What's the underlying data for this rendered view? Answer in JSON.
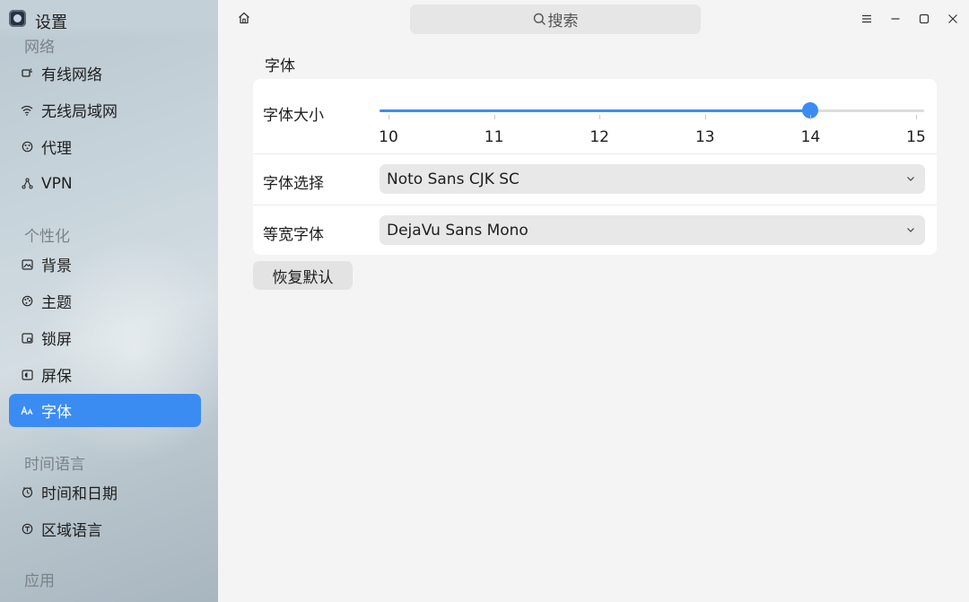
{
  "app": {
    "title": "设置"
  },
  "sidebar": {
    "partial_top_label": "网络",
    "network_items": [
      {
        "label": "有线网络",
        "icon": "wired-network-icon"
      },
      {
        "label": "无线局域网",
        "icon": "wifi-icon"
      },
      {
        "label": "代理",
        "icon": "proxy-icon"
      },
      {
        "label": "VPN",
        "icon": "vpn-icon"
      }
    ],
    "personalization_label": "个性化",
    "personalization_items": [
      {
        "label": "背景",
        "icon": "wallpaper-icon"
      },
      {
        "label": "主题",
        "icon": "palette-icon"
      },
      {
        "label": "锁屏",
        "icon": "lock-screen-icon"
      },
      {
        "label": "屏保",
        "icon": "screensaver-icon"
      },
      {
        "label": "字体",
        "icon": "font-icon",
        "active": true
      }
    ],
    "time_lang_label": "时间语言",
    "time_lang_items": [
      {
        "label": "时间和日期",
        "icon": "clock-icon"
      },
      {
        "label": "区域语言",
        "icon": "region-language-icon"
      }
    ],
    "apps_label": "应用"
  },
  "topbar": {
    "search_placeholder": "搜索"
  },
  "page": {
    "title": "字体",
    "font_size": {
      "label": "字体大小",
      "ticks": [
        "10",
        "11",
        "12",
        "13",
        "14",
        "15"
      ],
      "min": 10,
      "max": 15,
      "value": 14
    },
    "font_select": {
      "label": "字体选择",
      "value": "Noto Sans CJK SC"
    },
    "mono_select": {
      "label": "等宽字体",
      "value": "DejaVu Sans Mono"
    },
    "reset_label": "恢复默认"
  },
  "colors": {
    "accent": "#3b8cf2"
  }
}
